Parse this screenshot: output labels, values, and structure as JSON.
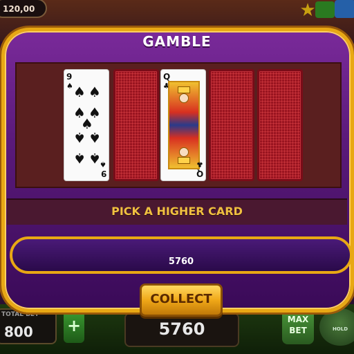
{
  "background": {
    "balance": "120,00",
    "total_bet_label": "TOTAL BET",
    "total_bet": "800",
    "plus_label": "+",
    "win_amount": "5760",
    "max_bet_label": "MAX BET",
    "hold_label": "HOLD"
  },
  "gamble": {
    "title": "GAMBLE",
    "hint": "PICK A HIGHER CARD",
    "win_amount": "5760",
    "collect_label": "COLLECT",
    "cards": [
      {
        "state": "face",
        "rank": "9",
        "suit": "♠"
      },
      {
        "state": "back"
      },
      {
        "state": "face",
        "rank": "Q",
        "suit": "♣"
      },
      {
        "state": "back"
      },
      {
        "state": "back"
      }
    ]
  },
  "colors": {
    "frame_gold": "#e8a814",
    "dialog_purple": "#6a1f8a",
    "table_maroon": "#5a1f1f",
    "hint_gold": "#f0c040",
    "card_back_red": "#9a1420"
  }
}
